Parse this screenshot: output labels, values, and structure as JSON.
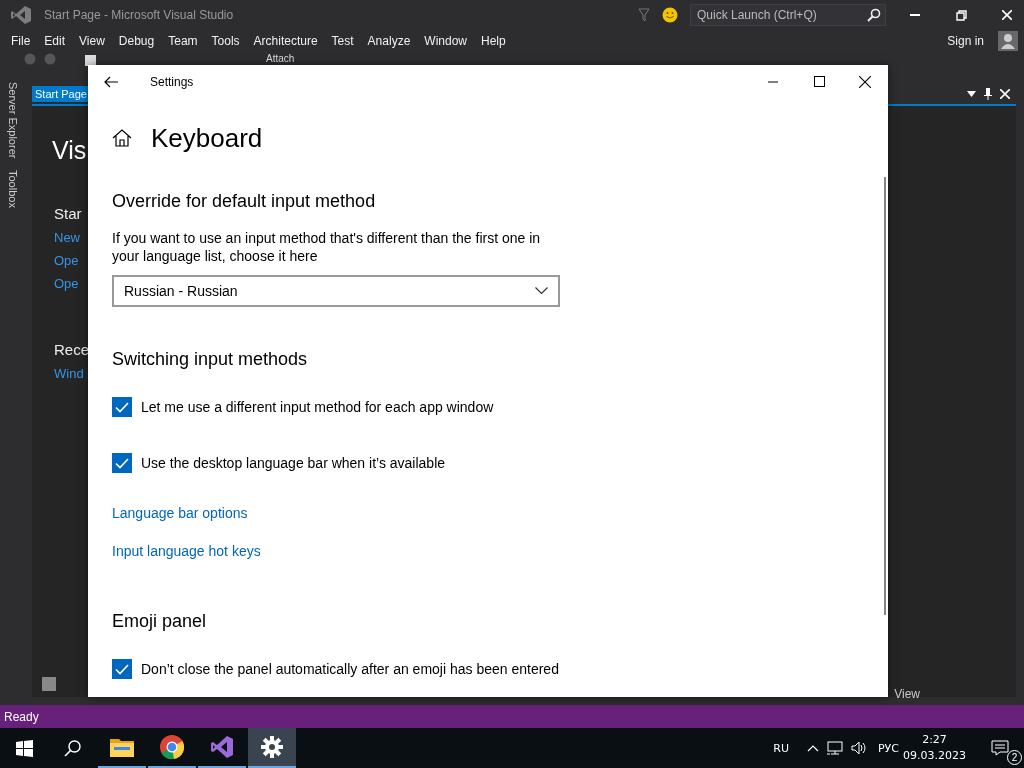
{
  "vs_window": {
    "title": "Start Page - Microsoft Visual Studio",
    "quick_launch": {
      "placeholder": "Quick Launch (Ctrl+Q)"
    },
    "sign_in": "Sign in",
    "menu": [
      "File",
      "Edit",
      "View",
      "Debug",
      "Team",
      "Tools",
      "Architecture",
      "Test",
      "Analyze",
      "Window",
      "Help"
    ],
    "toolbar": {
      "attach": "Attach"
    },
    "side_tabs": [
      "Server Explorer",
      "Toolbox"
    ],
    "document_tab": "Start Page",
    "start_page": {
      "title": "Vis",
      "start_heading": "Star",
      "start_links": [
        "New",
        "Ope",
        "Ope"
      ],
      "recent_heading": "Rece",
      "recent_links": [
        "Wind"
      ]
    },
    "bottom_tab": "View",
    "status_bar": "Ready"
  },
  "settings": {
    "title": "Settings",
    "page_title": "Keyboard",
    "sections": [
      {
        "heading": "Override for default input method",
        "items": [
          {
            "kind": "text",
            "text": "If you want to use an input method that's different than the first one in your language list, choose it here"
          },
          {
            "kind": "dropdown",
            "value": "Russian - Russian"
          }
        ]
      },
      {
        "heading": "Switching input methods",
        "items": [
          {
            "kind": "checkbox",
            "label": "Let me use a different input method for each app window",
            "checked": true
          },
          {
            "kind": "checkbox",
            "label": "Use the desktop language bar when it’s available",
            "checked": true
          },
          {
            "kind": "link",
            "text": "Language bar options"
          },
          {
            "kind": "link",
            "text": "Input language hot keys"
          }
        ]
      },
      {
        "heading": "Emoji panel",
        "items": [
          {
            "kind": "checkbox",
            "label": "Don’t close the panel automatically after an emoji has been entered",
            "checked": true
          }
        ]
      }
    ]
  },
  "taskbar": {
    "apps": [
      {
        "kind": "folder",
        "selected": false
      },
      {
        "kind": "browser",
        "selected": false
      },
      {
        "kind": "studio",
        "selected": false
      },
      {
        "kind": "gear",
        "selected": true
      }
    ],
    "language": "RU",
    "keyboard": "РУС",
    "time": "2:27",
    "date": "09.03.2023",
    "notifications": "2"
  }
}
